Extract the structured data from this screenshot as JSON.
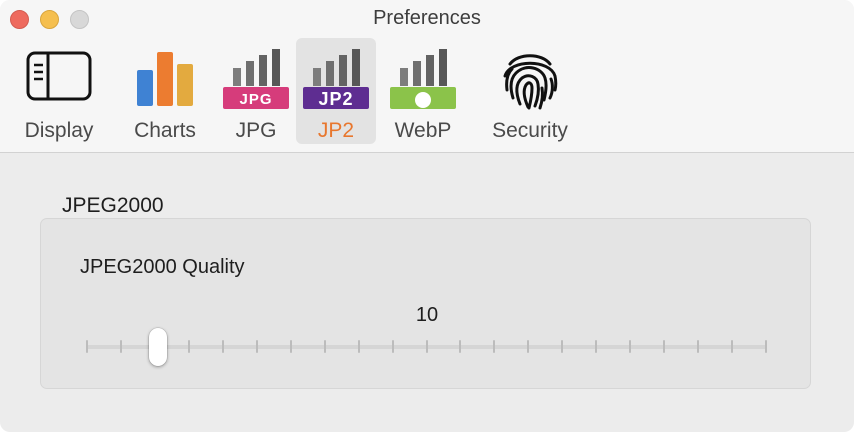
{
  "window": {
    "title": "Preferences"
  },
  "toolbar": {
    "selected": "jp2",
    "items": [
      {
        "id": "display",
        "label": "Display",
        "icon": "sidebar-window-icon"
      },
      {
        "id": "charts",
        "label": "Charts",
        "icon": "bar-chart-icon"
      },
      {
        "id": "jpg",
        "label": "JPG",
        "icon": "jpg-format-icon",
        "badge": "JPG"
      },
      {
        "id": "jp2",
        "label": "JP2",
        "icon": "jp2-format-icon",
        "badge": "JP2"
      },
      {
        "id": "webp",
        "label": "WebP",
        "icon": "webp-format-icon"
      },
      {
        "id": "security",
        "label": "Security",
        "icon": "fingerprint-icon"
      }
    ]
  },
  "section": {
    "title": "JPEG2000",
    "setting_label": "JPEG2000 Quality",
    "slider": {
      "value": "10",
      "min": 0,
      "max": 100,
      "position": 0.105,
      "ticks": 21
    }
  },
  "colors": {
    "accent": "#e8772e",
    "jpg_badge": "#d63c7b",
    "jp2_badge": "#5e2d91",
    "webp_badge": "#8bc34a"
  }
}
